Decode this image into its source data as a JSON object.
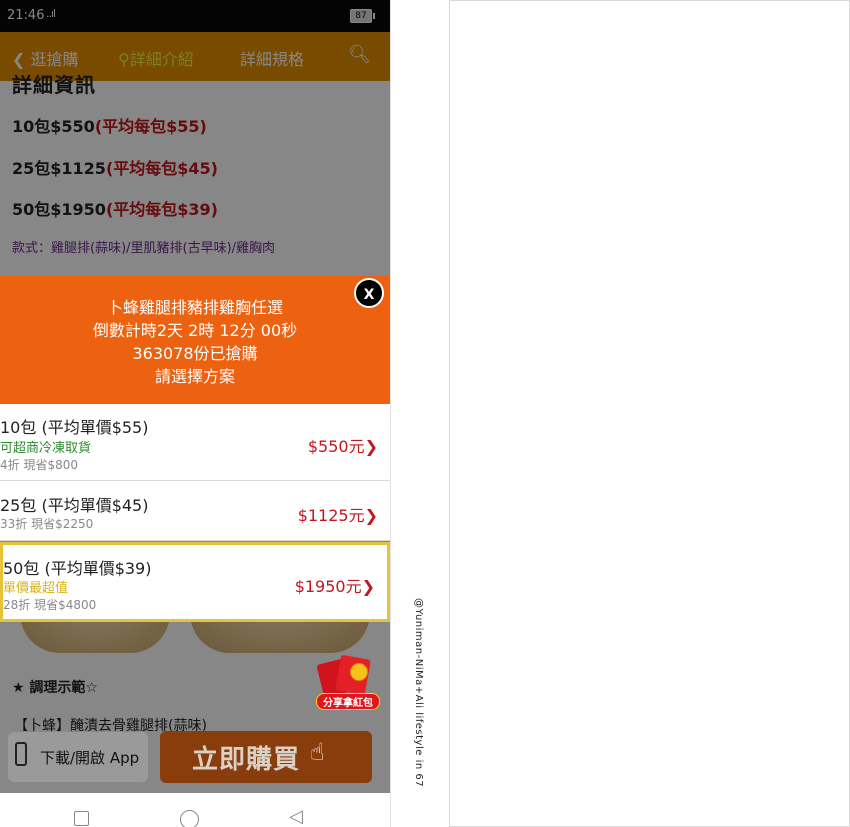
{
  "status_bar": {
    "time": "21:46",
    "signal": "..ıl",
    "battery": "87"
  },
  "nav": {
    "back_icon": "chevron-left-icon",
    "back_label": "逛搶購",
    "detail_icon": "location-pin-icon",
    "detail_label": "詳細介紹",
    "spec_label": "詳細規格",
    "search_icon": "search-icon"
  },
  "content": {
    "clipped_title": "詳細資訊",
    "price_lines": [
      {
        "main": "10包$550",
        "avg": "(平均每包$55)"
      },
      {
        "main": "25包$1125",
        "avg": "(平均每包$45)"
      },
      {
        "main": "50包$1950",
        "avg": "(平均每包$39)"
      }
    ],
    "styles": "款式：雞腿排(蒜味)/里肌豬排(古早味)/雞胸肉",
    "section_title": "★ 調理示範☆",
    "recipe_line": "【卜蜂】醃漬去骨雞腿排(蒜味)"
  },
  "modal": {
    "header_lines": [
      "卜蜂雞腿排豬排雞胸任選",
      "倒數計時2天 2時 12分 00秒",
      "363078份已搶購",
      "請選擇方案"
    ],
    "close_label": "X",
    "options": [
      {
        "title": "10包 (平均單價$55)",
        "note": "可超商冷凍取貨",
        "note_color": "#2e8b2e",
        "sub": "4折  現省$800",
        "price": "$550元",
        "chevron": "❯",
        "selected": false
      },
      {
        "title": "25包 (平均單價$45)",
        "note": "",
        "note_color": "#2e8b2e",
        "sub": "33折  現省$2250",
        "price": "$1125元",
        "chevron": "❯",
        "selected": false
      },
      {
        "title": "50包 (平均單價$39)",
        "note": "單價最超值",
        "note_color": "#d6b41c",
        "sub": "28折  現省$4800",
        "price": "$1950元",
        "chevron": "❯",
        "selected": true
      }
    ]
  },
  "red_envelope": {
    "icon": "red-envelope-icon",
    "badge": "拆",
    "label": "分享拿紅包"
  },
  "bottom_bar": {
    "download_icon": "phone-icon",
    "download_label": "下載/開啟 App",
    "buy_label": "立即購買",
    "buy_icon": "hand-pointer-icon"
  },
  "system_nav": {
    "icons": [
      "square-icon",
      "home-circle-icon",
      "back-triangle-icon"
    ]
  },
  "watermark": "@Yuniman-NiMa+Ali lifestyle in 67"
}
